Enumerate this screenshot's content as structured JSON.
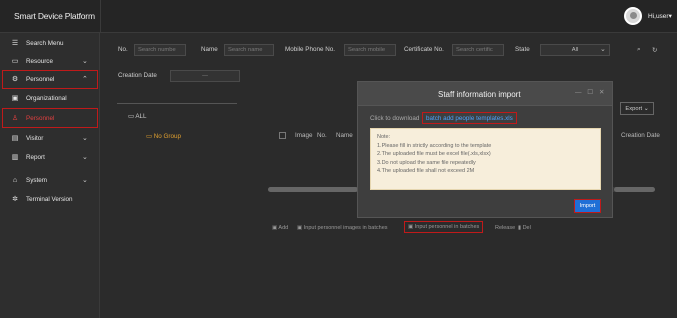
{
  "topbar": {
    "brand": "Smart Device Platform",
    "user": "Hi,user",
    "user_caret": "▾"
  },
  "sidebar": {
    "items": [
      {
        "label": "Search Menu",
        "icon": "search-icon"
      },
      {
        "label": "Resource",
        "icon": "folder-icon"
      },
      {
        "label": "Personnel",
        "icon": "gear-icon"
      },
      {
        "label": "Organizational",
        "icon": "org-icon"
      },
      {
        "label": "Personnel",
        "icon": "person-icon"
      },
      {
        "label": "Visitor",
        "icon": "visitor-icon"
      },
      {
        "label": "Report",
        "icon": "chart-icon"
      },
      {
        "label": "System",
        "icon": "home-icon"
      },
      {
        "label": "Terminal Version",
        "icon": "settings-icon"
      }
    ]
  },
  "filters": {
    "no_label": "No.",
    "no_placeholder": "Search numbe",
    "name_label": "Name",
    "name_placeholder": "Search name",
    "mobile_label": "Mobile Phone No.",
    "mobile_placeholder": "Search mobile",
    "cert_label": "Certificate No.",
    "cert_placeholder": "Search certific",
    "state_label": "State",
    "state_value": "All",
    "creation_label": "Creation Date",
    "creation_value": "—"
  },
  "tree": {
    "all": "ALL",
    "group": "No Group"
  },
  "table": {
    "col_image": "Image",
    "col_no": "No.",
    "col_name": "Name",
    "col_creation": "Creation Date",
    "export": "Export"
  },
  "toolbar": {
    "add": "Add",
    "import_images": "Input personnel images in batches",
    "import_personnel": "Input personnel in batches",
    "release": "Release",
    "del": "Del"
  },
  "modal": {
    "title": "Staff information import",
    "controls": "— ☐ ✕",
    "download_label": "Click to download",
    "download_link": "batch add people templates.xls",
    "note_title": "Note:",
    "notes": [
      "1.Please fill in strictly according to the template",
      "2.The uploaded file must be excel file(.xls,xlsx)",
      "3.Do not upload the same file repeatedly",
      "4.The uploaded file shall not exceed 2M"
    ],
    "import": "Import"
  }
}
